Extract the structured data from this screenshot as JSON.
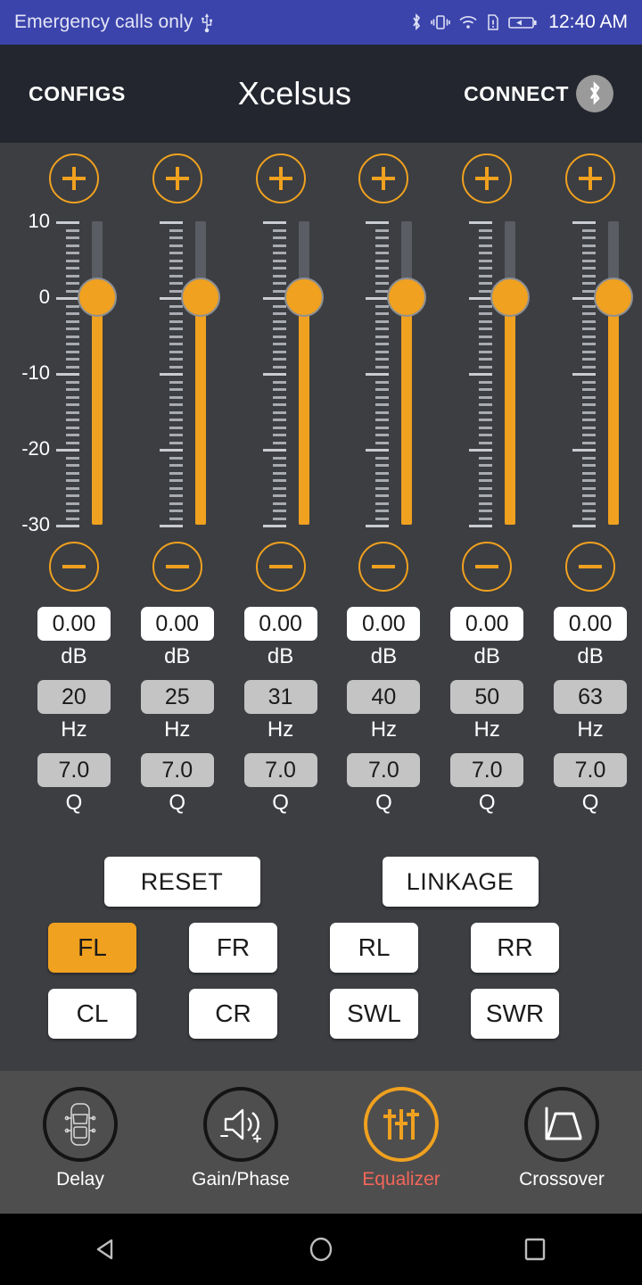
{
  "statusbar": {
    "carrier": "Emergency calls only",
    "time": "12:40 AM",
    "icons": [
      "usb-icon",
      "bluetooth-icon",
      "vibrate-icon",
      "wifi-icon",
      "sim-alert-icon",
      "battery-charging-icon"
    ]
  },
  "appbar": {
    "configs_label": "CONFIGS",
    "title": "Xcelsus",
    "connect_label": "CONNECT",
    "bluetooth_icon": "bluetooth-icon"
  },
  "eq": {
    "scale": {
      "labels": [
        "10",
        "0",
        "-10",
        "-20",
        "-30"
      ],
      "max": 10,
      "min": -30,
      "unit": "dB"
    },
    "plus_glyph": "+",
    "minus_glyph": "−",
    "units": {
      "gain": "dB",
      "freq": "Hz",
      "q": "Q"
    },
    "bands": [
      {
        "gain": "0.00",
        "freq": "20",
        "q": "7.0",
        "value": 0
      },
      {
        "gain": "0.00",
        "freq": "25",
        "q": "7.0",
        "value": 0
      },
      {
        "gain": "0.00",
        "freq": "31",
        "q": "7.0",
        "value": 0
      },
      {
        "gain": "0.00",
        "freq": "40",
        "q": "7.0",
        "value": 0
      },
      {
        "gain": "0.00",
        "freq": "50",
        "q": "7.0",
        "value": 0
      },
      {
        "gain": "0.00",
        "freq": "63",
        "q": "7.0",
        "value": 0
      }
    ]
  },
  "actions": {
    "reset_label": "RESET",
    "linkage_label": "LINKAGE",
    "channels": [
      {
        "label": "FL",
        "active": true
      },
      {
        "label": "FR",
        "active": false
      },
      {
        "label": "RL",
        "active": false
      },
      {
        "label": "RR",
        "active": false
      },
      {
        "label": "CL",
        "active": false
      },
      {
        "label": "CR",
        "active": false
      },
      {
        "label": "SWL",
        "active": false
      },
      {
        "label": "SWR",
        "active": false
      }
    ]
  },
  "bottomnav": {
    "items": [
      {
        "label": "Delay",
        "icon": "car-top-view-icon",
        "active": false
      },
      {
        "label": "Gain/Phase",
        "icon": "speaker-volume-icon",
        "active": false
      },
      {
        "label": "Equalizer",
        "icon": "equalizer-sliders-icon",
        "active": true
      },
      {
        "label": "Crossover",
        "icon": "crossover-trapezoid-icon",
        "active": false
      }
    ]
  },
  "androidnav": {
    "back_label": "back-icon",
    "home_label": "home-icon",
    "recents_label": "recents-icon"
  },
  "colors": {
    "accent": "#f0a11f",
    "status_bar": "#3b44ab",
    "app_bar": "#23262e",
    "background": "#3c3e42",
    "nav_bar": "#4e4e4e",
    "active_label": "#f4665a"
  }
}
